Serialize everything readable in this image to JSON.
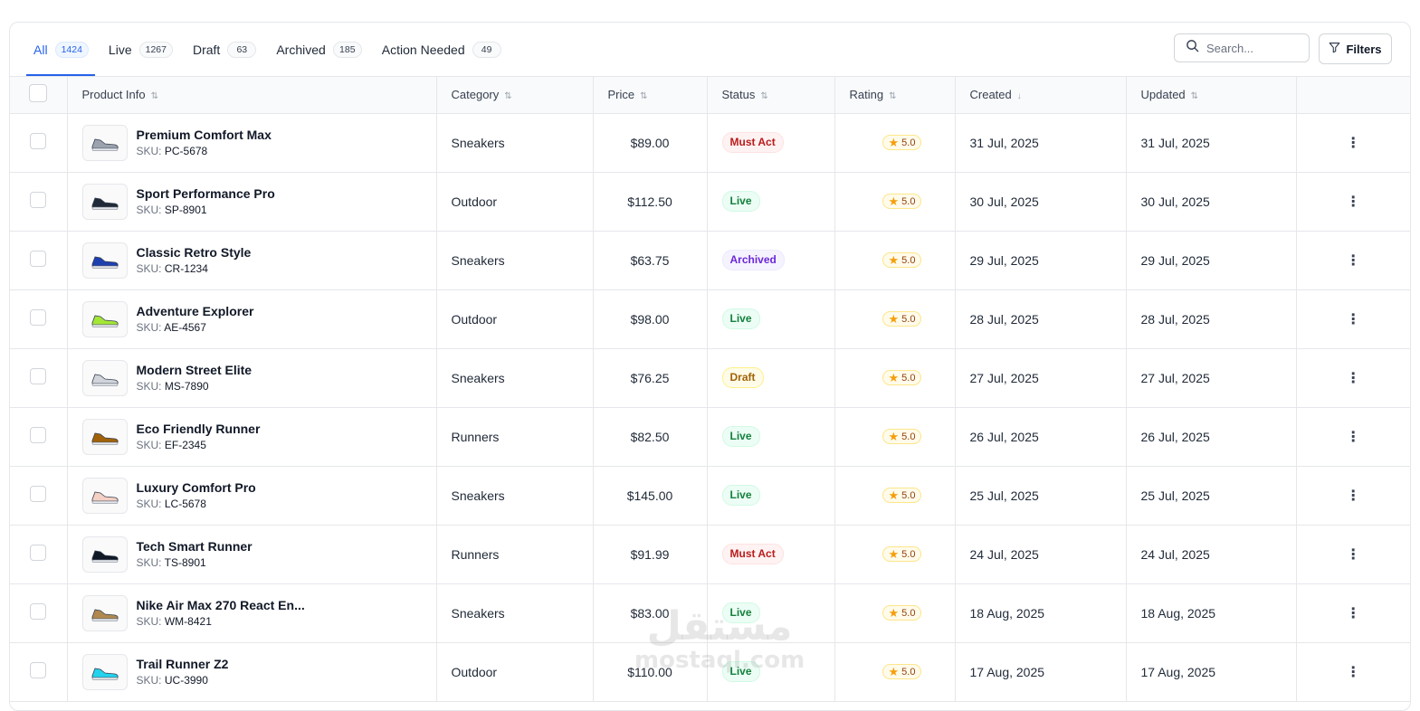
{
  "tabs": [
    {
      "label": "All",
      "count": "1424"
    },
    {
      "label": "Live",
      "count": "1267"
    },
    {
      "label": "Draft",
      "count": "63"
    },
    {
      "label": "Archived",
      "count": "185"
    },
    {
      "label": "Action Needed",
      "count": "49"
    }
  ],
  "search": {
    "placeholder": "Search..."
  },
  "filters_label": "Filters",
  "columns": {
    "product": "Product Info",
    "category": "Category",
    "price": "Price",
    "status": "Status",
    "rating": "Rating",
    "created": "Created",
    "updated": "Updated"
  },
  "sku_prefix": "SKU:",
  "rows": [
    {
      "name": "Premium Comfort Max",
      "sku": "PC-5678",
      "category": "Sneakers",
      "price": "$89.00",
      "status": "Must Act",
      "rating": "5.0",
      "created": "31 Jul, 2025",
      "updated": "31 Jul, 2025"
    },
    {
      "name": "Sport Performance Pro",
      "sku": "SP-8901",
      "category": "Outdoor",
      "price": "$112.50",
      "status": "Live",
      "rating": "5.0",
      "created": "30 Jul, 2025",
      "updated": "30 Jul, 2025"
    },
    {
      "name": "Classic Retro Style",
      "sku": "CR-1234",
      "category": "Sneakers",
      "price": "$63.75",
      "status": "Archived",
      "rating": "5.0",
      "created": "29 Jul, 2025",
      "updated": "29 Jul, 2025"
    },
    {
      "name": "Adventure Explorer",
      "sku": "AE-4567",
      "category": "Outdoor",
      "price": "$98.00",
      "status": "Live",
      "rating": "5.0",
      "created": "28 Jul, 2025",
      "updated": "28 Jul, 2025"
    },
    {
      "name": "Modern Street Elite",
      "sku": "MS-7890",
      "category": "Sneakers",
      "price": "$76.25",
      "status": "Draft",
      "rating": "5.0",
      "created": "27 Jul, 2025",
      "updated": "27 Jul, 2025"
    },
    {
      "name": "Eco Friendly Runner",
      "sku": "EF-2345",
      "category": "Runners",
      "price": "$82.50",
      "status": "Live",
      "rating": "5.0",
      "created": "26 Jul, 2025",
      "updated": "26 Jul, 2025"
    },
    {
      "name": "Luxury Comfort Pro",
      "sku": "LC-5678",
      "category": "Sneakers",
      "price": "$145.00",
      "status": "Live",
      "rating": "5.0",
      "created": "25 Jul, 2025",
      "updated": "25 Jul, 2025"
    },
    {
      "name": "Tech Smart Runner",
      "sku": "TS-8901",
      "category": "Runners",
      "price": "$91.99",
      "status": "Must Act",
      "rating": "5.0",
      "created": "24 Jul, 2025",
      "updated": "24 Jul, 2025"
    },
    {
      "name": "Nike Air Max 270 React En...",
      "sku": "WM-8421",
      "category": "Sneakers",
      "price": "$83.00",
      "status": "Live",
      "rating": "5.0",
      "created": "18 Aug, 2025",
      "updated": "18 Aug, 2025"
    },
    {
      "name": "Trail Runner Z2",
      "sku": "UC-3990",
      "category": "Outdoor",
      "price": "$110.00",
      "status": "Live",
      "rating": "5.0",
      "created": "17 Aug, 2025",
      "updated": "17 Aug, 2025"
    }
  ],
  "shoe_colors": [
    "#9ca3af",
    "#1f2937",
    "#1e40af",
    "#a3e635",
    "#d1d5db",
    "#a16207",
    "#f5d0c5",
    "#111827",
    "#b08950",
    "#22d3ee"
  ],
  "watermark": {
    "line1": "مستقل",
    "line2": "mostaql.com"
  }
}
